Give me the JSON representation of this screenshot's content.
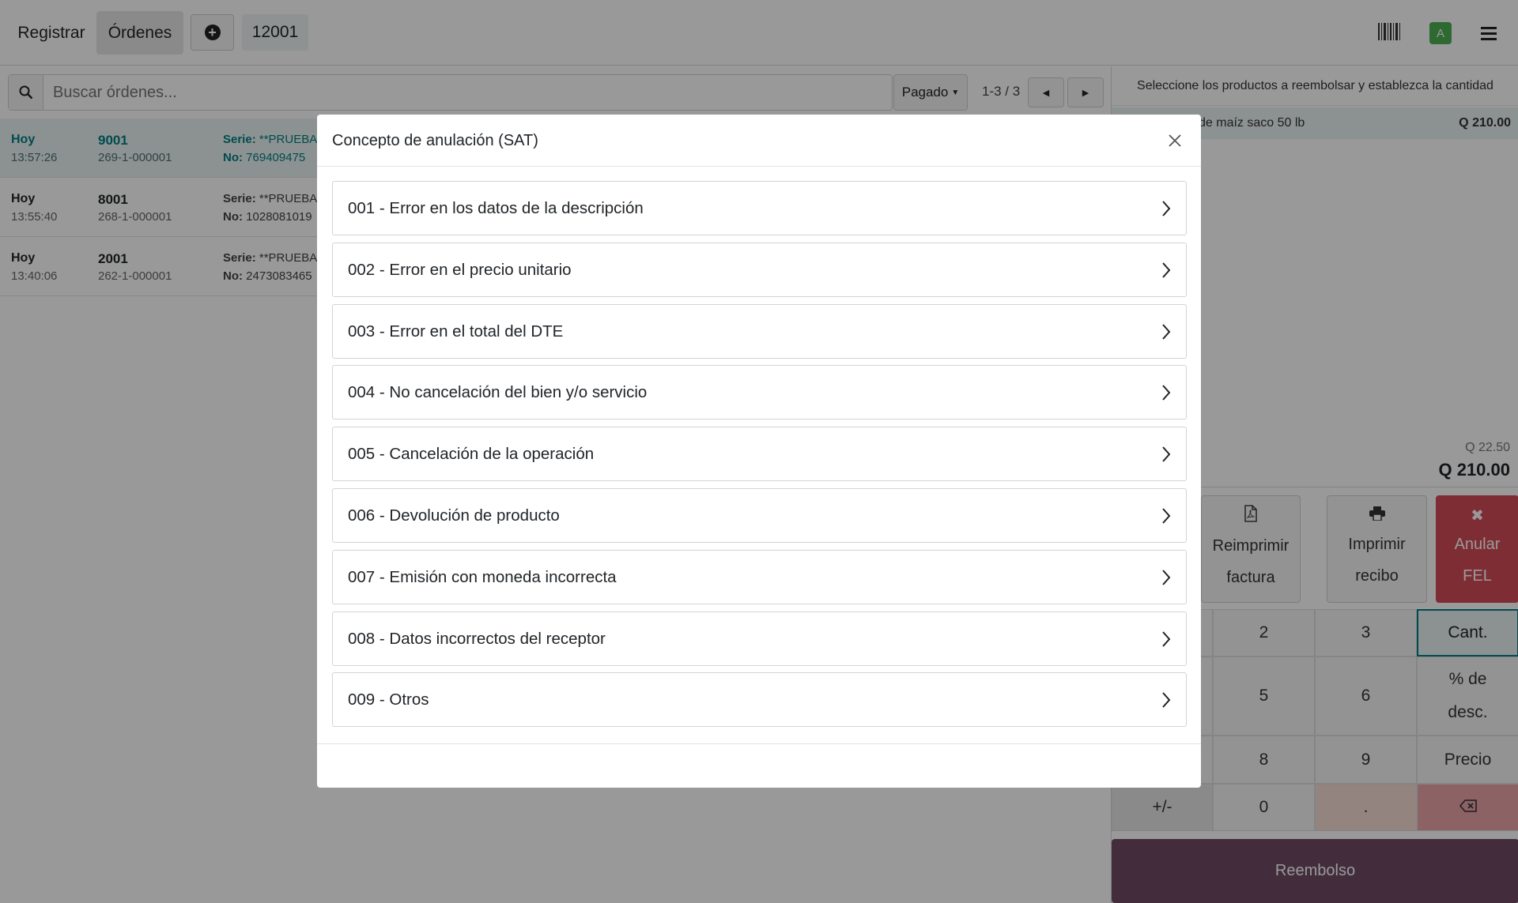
{
  "topbar": {
    "register_label": "Registrar",
    "orders_label": "Órdenes",
    "order_number": "12001",
    "avatar_letter": "A",
    "icons": [
      "plus-circle-icon",
      "barcode-icon",
      "hamburger-menu-icon"
    ]
  },
  "orders_panel": {
    "search_placeholder": "Buscar órdenes...",
    "filter_label": "Pagado",
    "pager": "1-3 / 3",
    "rows": [
      {
        "day": "Hoy",
        "time": "13:57:26",
        "number": "9001",
        "ref": "269-1-000001",
        "serie_label": "Serie:",
        "serie_value": " **PRUEBA",
        "no_label": "No:",
        "no_value": " 769409475"
      },
      {
        "day": "Hoy",
        "time": "13:55:40",
        "number": "8001",
        "ref": "268-1-000001",
        "serie_label": "Serie:",
        "serie_value": " **PRUEBA",
        "no_label": "No:",
        "no_value": " 1028081019"
      },
      {
        "day": "Hoy",
        "time": "13:40:06",
        "number": "2001",
        "ref": "262-1-000001",
        "serie_label": "Serie:",
        "serie_value": " **PRUEBA",
        "no_label": "No:",
        "no_value": " 2473083465"
      }
    ]
  },
  "refund_panel": {
    "hint": "Seleccione los productos a reembolsar y establezca la cantidad",
    "line_name": "de maíz saco 50 lb",
    "line_price": "Q 210.00",
    "tax": "Q 22.50",
    "total": "Q 210.00",
    "actions": {
      "reprint_line1": "Reimprimir",
      "reprint_line2": "factura",
      "print_line1": "Imprimir",
      "print_line2": "recibo",
      "void_line1": "Anular",
      "void_line2": "FEL",
      "void_icon": "✖"
    },
    "keys": {
      "k2": "2",
      "k3": "3",
      "cant": "Cant.",
      "k5": "5",
      "k6": "6",
      "disc_line1": "% de",
      "disc_line2": "desc.",
      "k8": "8",
      "k9": "9",
      "price": "Precio",
      "plusminus": "+/-",
      "k0": "0",
      "dot": "."
    },
    "refund_label": "Reembolso"
  },
  "modal": {
    "title": "Concepto de anulación (SAT)",
    "reasons": [
      {
        "label": "001 - Error en los datos de la descripción"
      },
      {
        "label": "002 - Error en el precio unitario"
      },
      {
        "label": "003 - Error en el total del DTE"
      },
      {
        "label": "004 - No cancelación del bien y/o servicio"
      },
      {
        "label": "005 - Cancelación de la operación"
      },
      {
        "label": "006 - Devolución de producto"
      },
      {
        "label": "007 - Emisión con moneda incorrecta"
      },
      {
        "label": "008 - Datos incorrectos del receptor"
      },
      {
        "label": "009 - Otros"
      }
    ]
  },
  "colors": {
    "accent_teal": "#017e84",
    "void_red": "#d44c59",
    "refund_purple": "#714b67",
    "avatar_green": "#4caf50"
  }
}
